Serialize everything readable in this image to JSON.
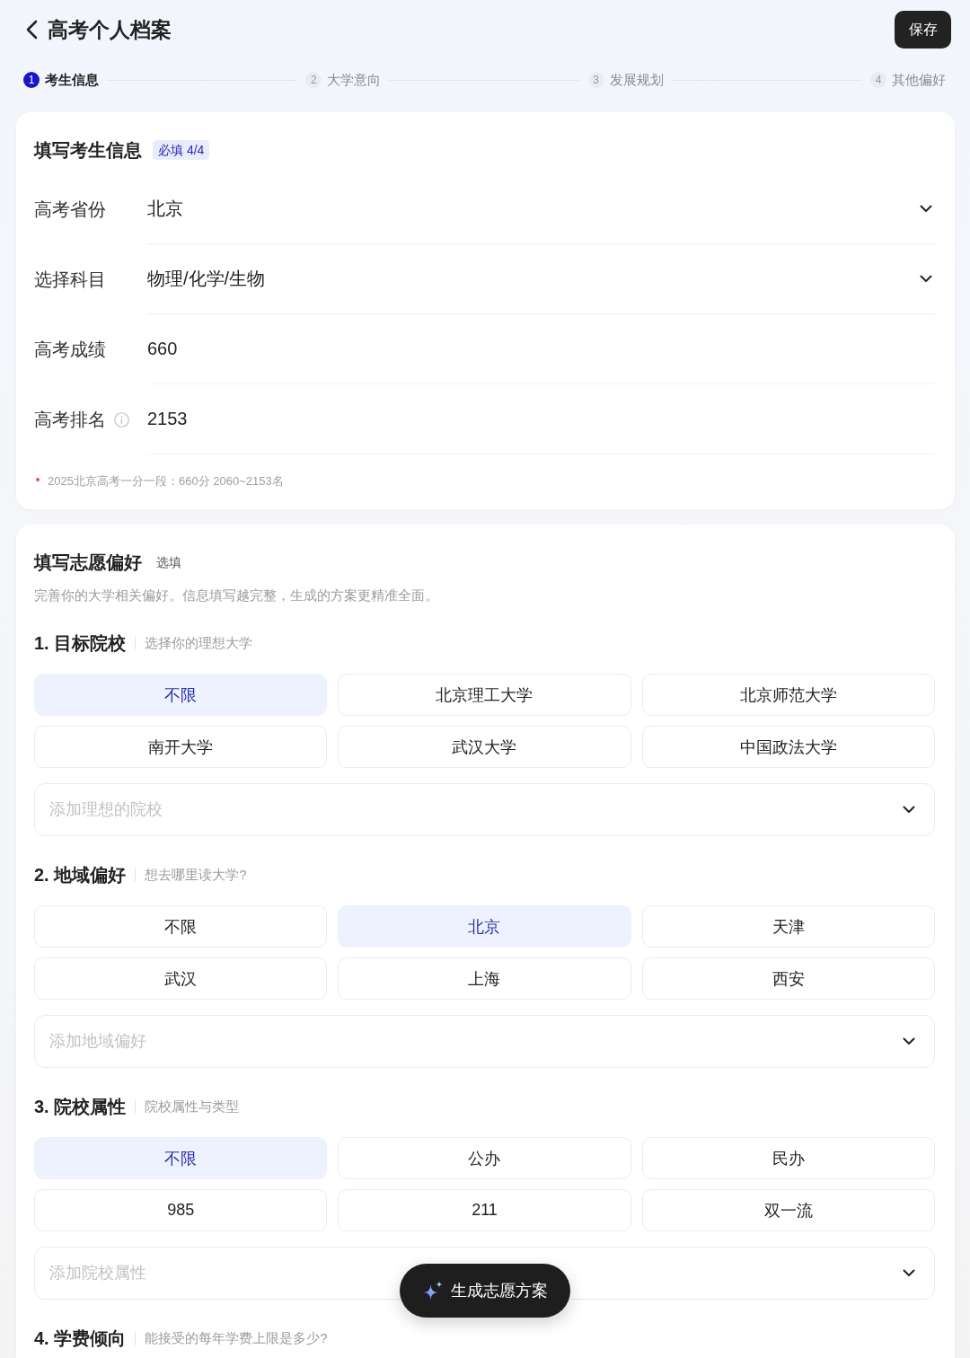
{
  "header": {
    "title": "高考个人档案",
    "save_button": "保存"
  },
  "steps": [
    {
      "number": "1",
      "label": "考生信息",
      "selected": true
    },
    {
      "number": "2",
      "label": "大学意向",
      "selected": false
    },
    {
      "number": "3",
      "label": "发展规划",
      "selected": false
    },
    {
      "number": "4",
      "label": "其他偏好",
      "selected": false
    }
  ],
  "student_info": {
    "title": "填写考生信息",
    "badge": "必填 4/4",
    "fields": [
      {
        "label": "高考省份",
        "value": "北京",
        "kind": "select"
      },
      {
        "label": "选择科目",
        "value": "物理/化学/生物",
        "kind": "select"
      },
      {
        "label": "高考成绩",
        "value": "660",
        "kind": "input"
      },
      {
        "label": "高考排名",
        "value": "2153",
        "kind": "input",
        "info": true
      }
    ],
    "note": "2025北京高考一分一段：660分 2060~2153名"
  },
  "preferences": {
    "title": "填写志愿偏好",
    "tag": "选填",
    "description": "完善你的大学相关偏好。信息填写越完整，生成的方案更精准全面。",
    "sections": [
      {
        "heading": "1. 目标院校",
        "hint": "选择你的理想大学",
        "options": [
          {
            "label": "不限",
            "selected": true
          },
          {
            "label": "北京理工大学",
            "selected": false
          },
          {
            "label": "北京师范大学",
            "selected": false
          },
          {
            "label": "南开大学",
            "selected": false
          },
          {
            "label": "武汉大学",
            "selected": false
          },
          {
            "label": "中国政法大学",
            "selected": false
          }
        ],
        "placeholder": "添加理想的院校"
      },
      {
        "heading": "2. 地域偏好",
        "hint": "想去哪里读大学?",
        "options": [
          {
            "label": "不限",
            "selected": false
          },
          {
            "label": "北京",
            "selected": true
          },
          {
            "label": "天津",
            "selected": false
          },
          {
            "label": "武汉",
            "selected": false
          },
          {
            "label": "上海",
            "selected": false
          },
          {
            "label": "西安",
            "selected": false
          }
        ],
        "placeholder": "添加地域偏好"
      },
      {
        "heading": "3. 院校属性",
        "hint": "院校属性与类型",
        "options": [
          {
            "label": "不限",
            "selected": true
          },
          {
            "label": "公办",
            "selected": false
          },
          {
            "label": "民办",
            "selected": false
          },
          {
            "label": "985",
            "selected": false
          },
          {
            "label": "211",
            "selected": false
          },
          {
            "label": "双一流",
            "selected": false
          }
        ],
        "placeholder": "添加院校属性"
      },
      {
        "heading": "4. 学费倾向",
        "hint": "能接受的每年学费上限是多少?"
      }
    ]
  },
  "generate_button": "生成志愿方案"
}
